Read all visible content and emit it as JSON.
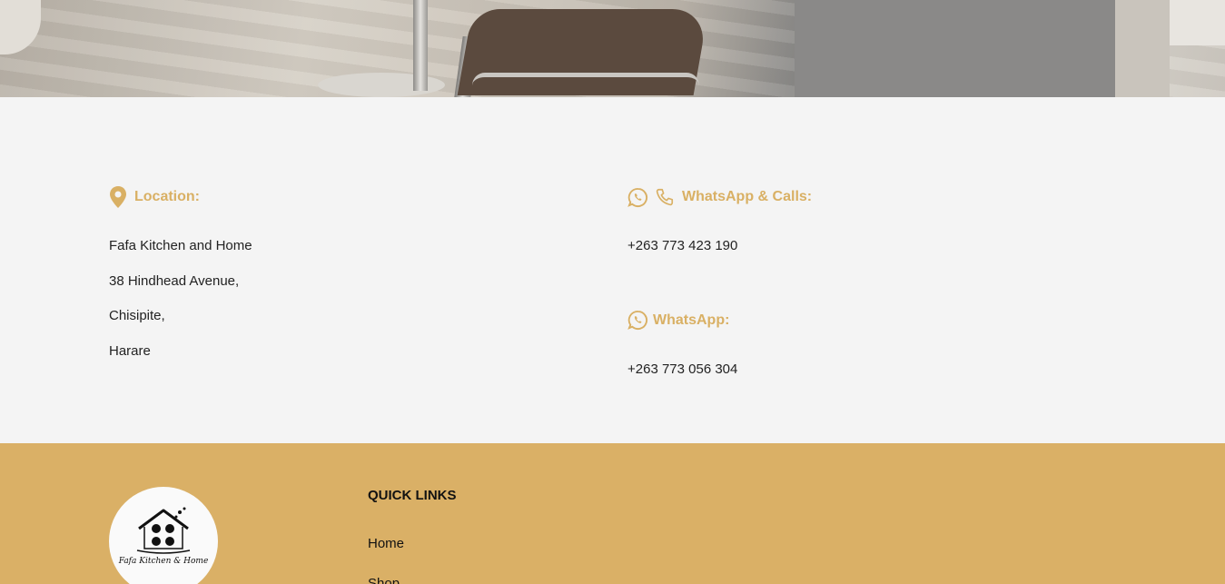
{
  "contact": {
    "location": {
      "label": "Location:",
      "icon": "map-pin-icon",
      "lines": [
        "Fafa Kitchen and Home",
        "38 Hindhead Avenue,",
        "Chisipite,",
        "Harare"
      ]
    },
    "whatsapp_calls": {
      "label": "WhatsApp & Calls:",
      "icons": [
        "whatsapp-icon",
        "phone-icon"
      ],
      "number": "+263 773 423 190"
    },
    "whatsapp": {
      "label": "WhatsApp:",
      "icon": "whatsapp-icon",
      "number": "+263 773 056 304"
    },
    "accent_color": "#d9b064"
  },
  "footer": {
    "background_color": "#dab066",
    "logo_text": "Fafa Kitchen & Home",
    "quick_links": {
      "title": "QUICK LINKS",
      "items": [
        "Home",
        "Shop"
      ]
    }
  }
}
